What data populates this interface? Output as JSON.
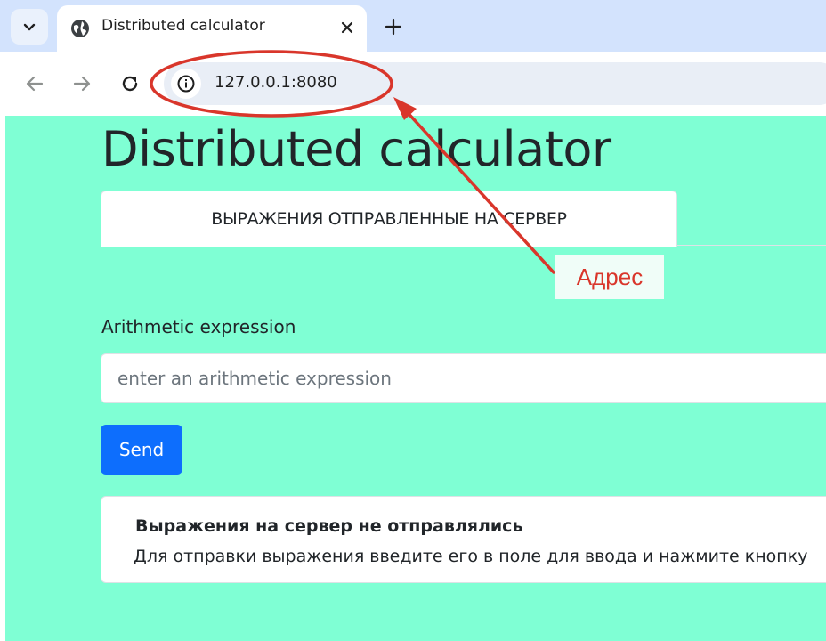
{
  "browser": {
    "tab": {
      "title": "Distributed calculator"
    },
    "address": {
      "url": "127.0.0.1:8080"
    },
    "icons": {
      "tab_search": "chevron-down-icon",
      "favicon": "globe-icon",
      "close": "close-icon",
      "new_tab": "plus-icon",
      "back": "arrow-left-icon",
      "forward": "arrow-right-icon",
      "reload": "reload-icon",
      "site_info": "info-icon"
    }
  },
  "page": {
    "title": "Distributed calculator",
    "nav_tab": "ВЫРАЖЕНИЯ ОТПРАВЛЕННЫЕ НА СЕРВЕР",
    "form": {
      "label": "Arithmetic expression",
      "input_value": "",
      "placeholder": "enter an arithmetic expression",
      "submit_label": "Send"
    },
    "card": {
      "title": "Выражения на сервер не отправлялись",
      "text": "Для отправки выражения введите его в поле для ввода и нажмите кнопку"
    }
  },
  "annotation": {
    "label": "Адрес",
    "color": "#d9362b"
  },
  "colors": {
    "page_background": "#7fffd4",
    "primary_button": "#0d6efd",
    "tabstrip": "#d3e3fd"
  }
}
